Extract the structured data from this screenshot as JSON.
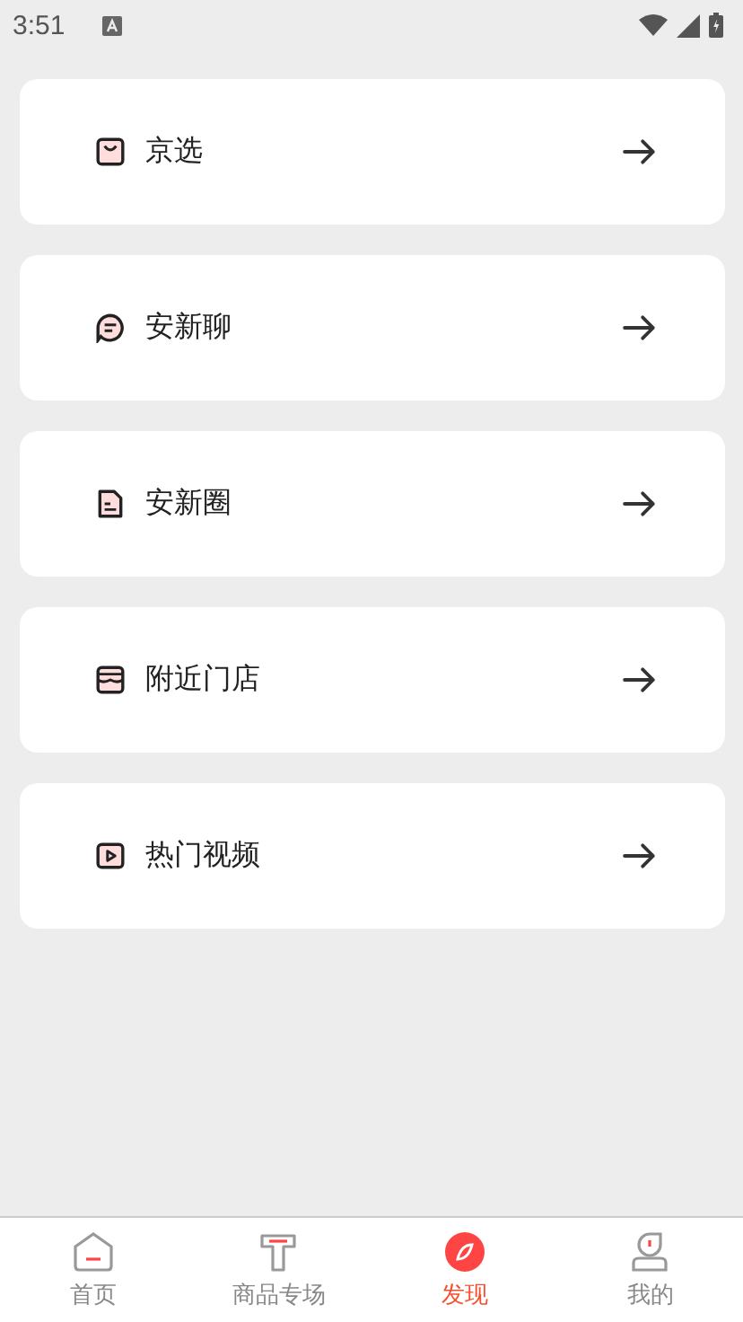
{
  "status_bar": {
    "time": "3:51"
  },
  "menu": [
    {
      "kind": "bag",
      "label": "京选"
    },
    {
      "kind": "chat",
      "label": "安新聊"
    },
    {
      "kind": "doc",
      "label": "安新圈"
    },
    {
      "kind": "store",
      "label": "附近门店"
    },
    {
      "kind": "video",
      "label": "热门视频"
    }
  ],
  "tab_bar": [
    {
      "kind": "home",
      "label": "首页",
      "selected": false
    },
    {
      "kind": "products",
      "label": "商品专场",
      "selected": false
    },
    {
      "kind": "discover",
      "label": "发现",
      "selected": true
    },
    {
      "kind": "me",
      "label": "我的",
      "selected": false
    }
  ]
}
